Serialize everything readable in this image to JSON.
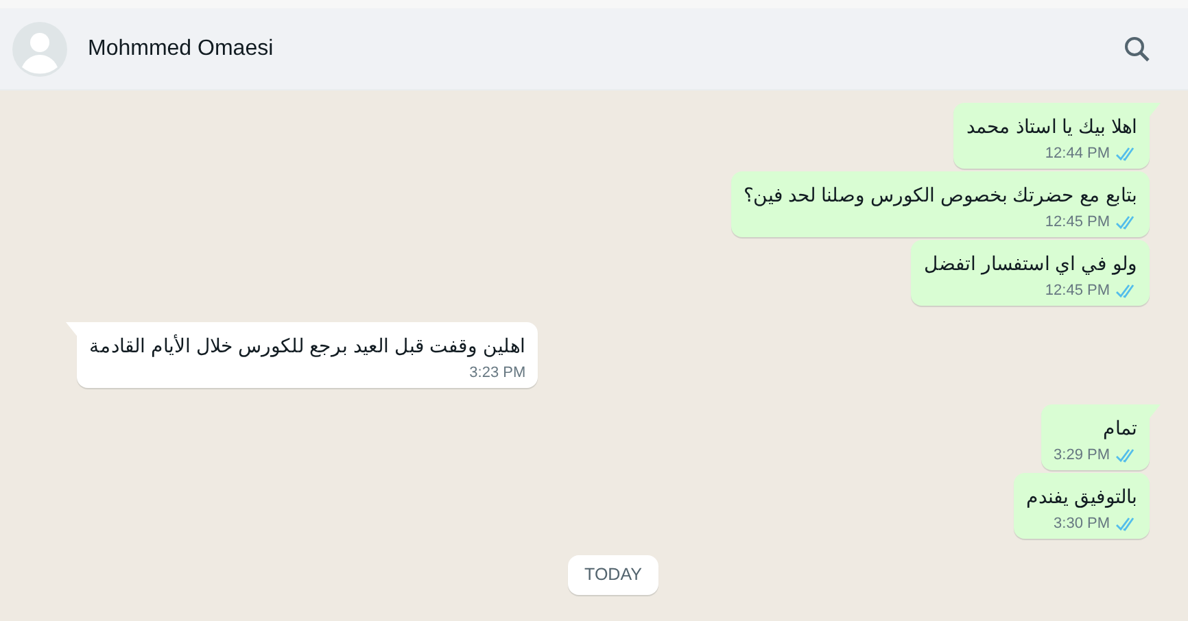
{
  "header": {
    "contact_name": "Mohmmed Omaesi"
  },
  "messages": [
    {
      "kind": "sent",
      "text": "اهلا بيك يا استاذ محمد",
      "time": "12:44 PM",
      "read": true,
      "tail": true
    },
    {
      "kind": "sent",
      "text": "بتابع مع حضرتك بخصوص الكورس وصلنا لحد فين؟",
      "time": "12:45 PM",
      "read": true,
      "tail": false
    },
    {
      "kind": "sent",
      "text": "ولو في اي استفسار اتفضل",
      "time": "12:45 PM",
      "read": true,
      "tail": false
    },
    {
      "kind": "received",
      "text": "اهلين وقفت قبل العيد برجع للكورس خلال الأيام القادمة",
      "time": "3:23 PM",
      "tail": true
    },
    {
      "kind": "sent",
      "text": "تمام",
      "time": "3:29 PM",
      "read": true,
      "tail": true
    },
    {
      "kind": "sent",
      "text": "بالتوفيق يفندم",
      "time": "3:30 PM",
      "read": true,
      "tail": false
    },
    {
      "kind": "date",
      "text": "TODAY"
    }
  ]
}
